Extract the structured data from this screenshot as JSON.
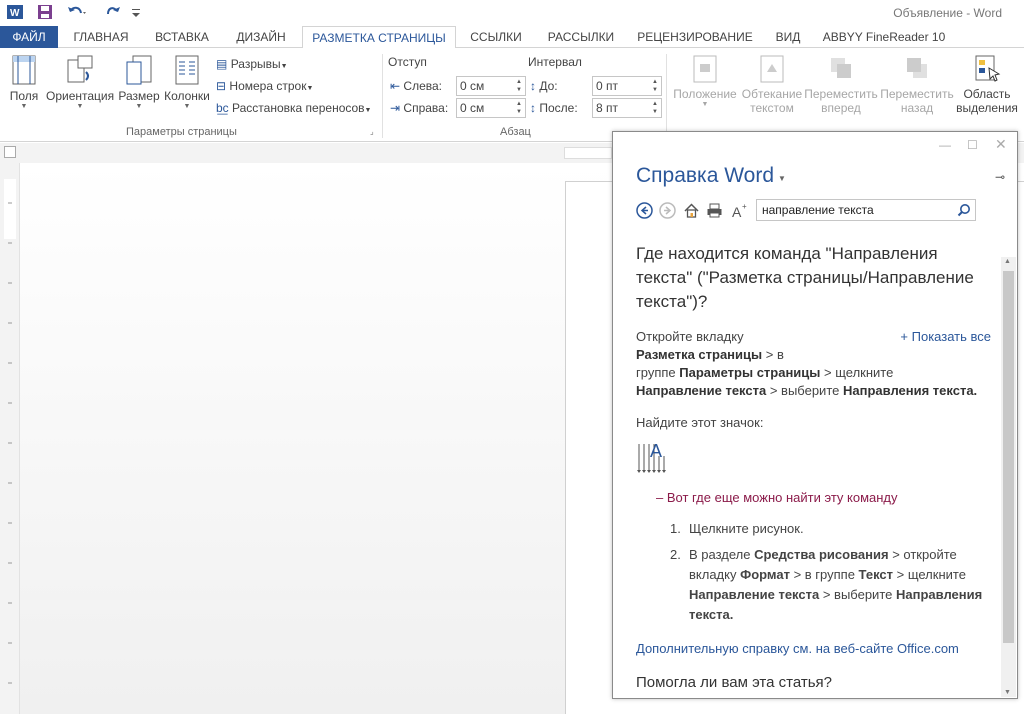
{
  "title_bar": {
    "doc_title": "Объявление - Word"
  },
  "tabs": [
    {
      "label": "ФАЙЛ"
    },
    {
      "label": "ГЛАВНАЯ"
    },
    {
      "label": "ВСТАВКА"
    },
    {
      "label": "ДИЗАЙН"
    },
    {
      "label": "РАЗМЕТКА СТРАНИЦЫ"
    },
    {
      "label": "ССЫЛКИ"
    },
    {
      "label": "РАССЫЛКИ"
    },
    {
      "label": "РЕЦЕНЗИРОВАНИЕ"
    },
    {
      "label": "ВИД"
    },
    {
      "label": "ABBYY FineReader 10"
    }
  ],
  "ribbon": {
    "page_setup": {
      "fields": "Поля",
      "orientation": "Ориентация",
      "size": "Размер",
      "columns": "Колонки",
      "breaks": "Разрывы",
      "line_numbers": "Номера строк",
      "hyphenation": "Расстановка переносов",
      "group_label": "Параметры страницы"
    },
    "paragraph": {
      "indent_label": "Отступ",
      "spacing_label": "Интервал",
      "left_label": "Слева:",
      "left_value": "0 см",
      "right_label": "Справа:",
      "right_value": "0 см",
      "before_label": "До:",
      "before_value": "0 пт",
      "after_label": "После:",
      "after_value": "8 пт",
      "group_label": "Абзац"
    },
    "arrange": {
      "position": "Положение",
      "wrap_1": "Обтекание",
      "wrap_2": "текстом",
      "forward_1": "Переместить",
      "forward_2": "вперед",
      "backward_1": "Переместить",
      "backward_2": "назад",
      "selection_1": "Область",
      "selection_2": "выделения"
    }
  },
  "help": {
    "title": "Справка Word",
    "search_value": "направление текста",
    "question": "Где находится команда \"Направления текста\" (\"Разметка страницы/Направление текста\")?",
    "show_all": "+ Показать все",
    "intro_1": "Откройте вкладку",
    "bold_page_layout": "Разметка страницы",
    "t_in": " > в",
    "t_group": "группе ",
    "bold_page_setup": "Параметры страницы",
    "t_click": " > щелкните",
    "bold_text_dir": "Направление текста",
    "t_choose": " > выберите ",
    "bold_text_dirs": "Направления текста.",
    "find_icon": "Найдите этот значок:",
    "alt_location": "– Вот где еще можно найти эту команду",
    "step1_num": "1.",
    "step1": "Щелкните рисунок.",
    "step2_num": "2.",
    "s2_a": "В разделе ",
    "s2_b": "Средства рисования",
    "s2_c": " > откройте",
    "s2_d": "вкладку ",
    "s2_e": "Формат",
    "s2_f": " > в группе ",
    "s2_g": "Текст",
    "s2_h": " > щелкните",
    "s2_i": "Направление текста",
    "s2_j": " > выберите ",
    "s2_k": "Направления",
    "s2_l": "текста.",
    "more_help": "Дополнительную справку см. на веб-сайте Office.com",
    "helpful": "Помогла ли вам эта статья?"
  },
  "colors": {
    "accent": "#2b579a",
    "alt_link": "#8b1b4a"
  }
}
